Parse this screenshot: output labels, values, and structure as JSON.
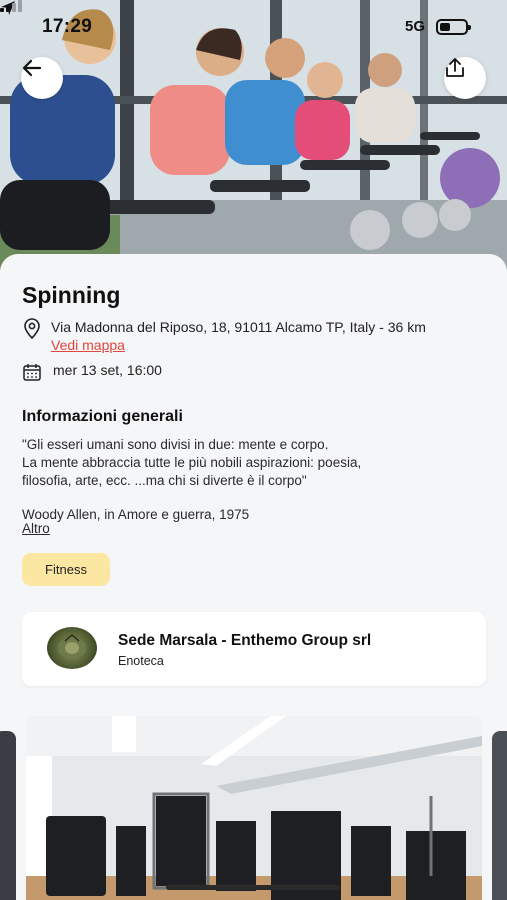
{
  "status_bar": {
    "time": "17:29",
    "network": "5G",
    "battery_level": 0.4
  },
  "hero": {
    "back_icon": "arrow-left-icon",
    "share_icon": "share-icon"
  },
  "event": {
    "title": "Spinning",
    "address": "Via Madonna del Riposo, 18, 91011 Alcamo TP, Italy - 36 km",
    "map_link": "Vedi mappa",
    "datetime": "mer 13 set, 16:00"
  },
  "info": {
    "heading": "Informazioni generali",
    "lines": [
      "\"Gli esseri umani sono divisi in due: mente e corpo.",
      "La mente abbraccia tutte le più nobili aspirazioni: poesia,",
      "filosofia, arte, ecc.  ...ma chi si diverte è il corpo\""
    ],
    "author": "Woody Allen, in Amore e guerra, 1975",
    "more_label": "Altro"
  },
  "tag": {
    "label": "Fitness"
  },
  "organizer": {
    "name": "Sede Marsala - Enthemo Group srl",
    "type": "Enoteca"
  },
  "colors": {
    "accent_link": "#e0463e",
    "tag_bg": "#fbe6a2",
    "background": "#f5f6f8"
  }
}
